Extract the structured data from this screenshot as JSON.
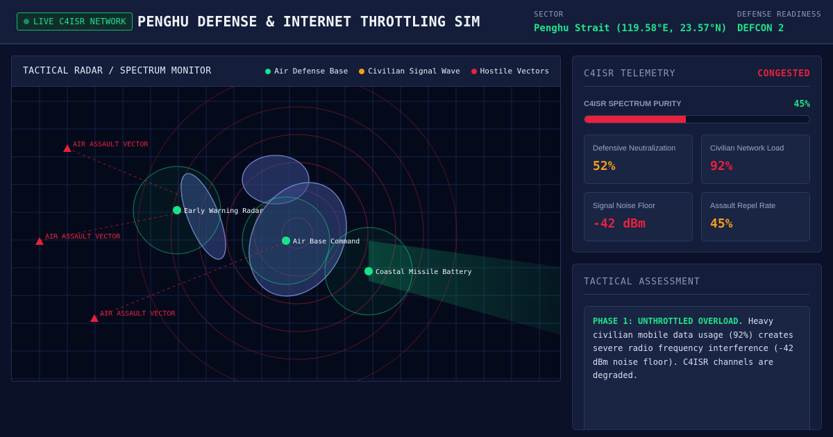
{
  "header": {
    "live_badge": "LIVE C4ISR NETWORK",
    "title": "PENGHU DEFENSE & INTERNET THROTTLING SIM",
    "sector_label": "SECTOR",
    "sector_value": "Penghu Strait (119.58°E, 23.57°N)",
    "readiness_label": "DEFENSE READINESS",
    "readiness_value": "DEFCON 2"
  },
  "radar": {
    "title": "TACTICAL RADAR / SPECTRUM MONITOR",
    "legend": [
      {
        "label": "Air Defense Base",
        "color": "#16e38a"
      },
      {
        "label": "Civilian Signal Wave",
        "color": "#f59e1b"
      },
      {
        "label": "Hostile Vectors",
        "color": "#e8213d"
      }
    ],
    "bases": [
      {
        "label": "Early Warning Radar"
      },
      {
        "label": "Air Base Command"
      },
      {
        "label": "Coastal Missile Battery"
      }
    ],
    "hostiles": [
      {
        "label": "AIR ASSAULT VECTOR"
      },
      {
        "label": "AIR ASSAULT VECTOR"
      },
      {
        "label": "AIR ASSAULT VECTOR"
      }
    ]
  },
  "telemetry": {
    "title": "C4ISR TELEMETRY",
    "status": "CONGESTED",
    "purity_label": "C4ISR SPECTRUM PURITY",
    "purity_value": "45%",
    "purity_fraction": 0.45,
    "stats": [
      {
        "label": "Defensive Neutralization",
        "value": "52%",
        "color": "#f59e1b"
      },
      {
        "label": "Civilian Network Load",
        "value": "92%",
        "color": "#e8213d"
      },
      {
        "label": "Signal Noise Floor",
        "value": "-42 dBm",
        "color": "#e8213d"
      },
      {
        "label": "Assault Repel Rate",
        "value": "45%",
        "color": "#f59e1b"
      }
    ]
  },
  "assessment": {
    "title": "TACTICAL ASSESSMENT",
    "phase": "PHASE 1: UNTHROTTLED OVERLOAD",
    "text": ". Heavy civilian mobile data usage (92%) creates severe radio frequency interference (-42 dBm noise floor). C4ISR channels are degraded."
  }
}
